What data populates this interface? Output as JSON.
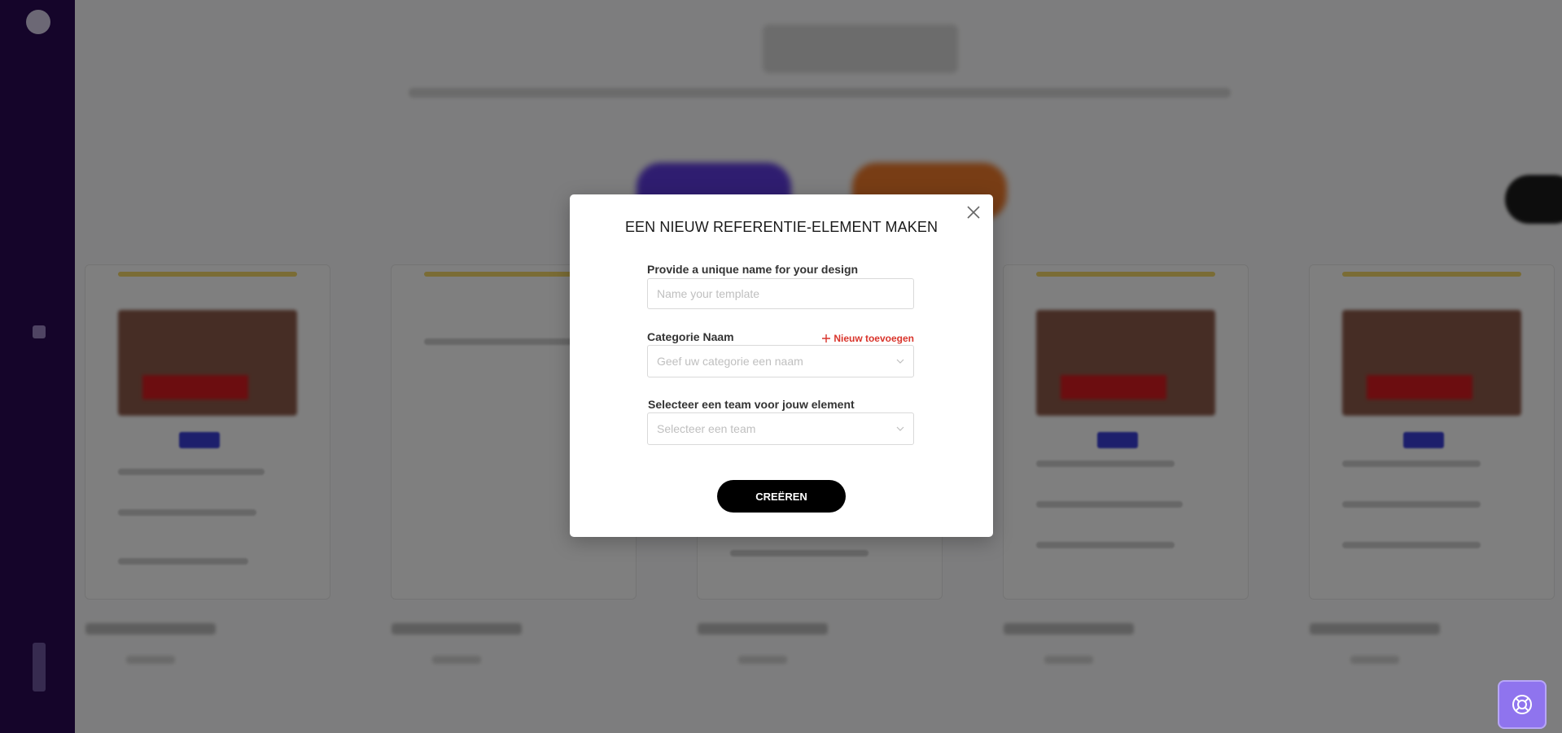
{
  "modal": {
    "title": "EEN NIEUW REFERENTIE-ELEMENT MAKEN",
    "name_field": {
      "label": "Provide a unique name for your design",
      "placeholder": "Name your template",
      "value": ""
    },
    "category_field": {
      "label": "Categorie Naam",
      "add_new_label": "Nieuw toevoegen",
      "placeholder": "Geef uw categorie een naam"
    },
    "team_field": {
      "label": "Selecteer een team voor jouw element",
      "placeholder": "Selecteer een team"
    },
    "submit_label": "CREËREN"
  },
  "icons": {
    "close": "close-icon",
    "plus": "plus-icon",
    "chevron": "chevron-down-icon",
    "help": "lifebuoy-icon"
  },
  "colors": {
    "sidebar": "#2a0a55",
    "accent_red": "#d9342b",
    "help_button": "#8f74ee",
    "primary_button": "#000000"
  }
}
